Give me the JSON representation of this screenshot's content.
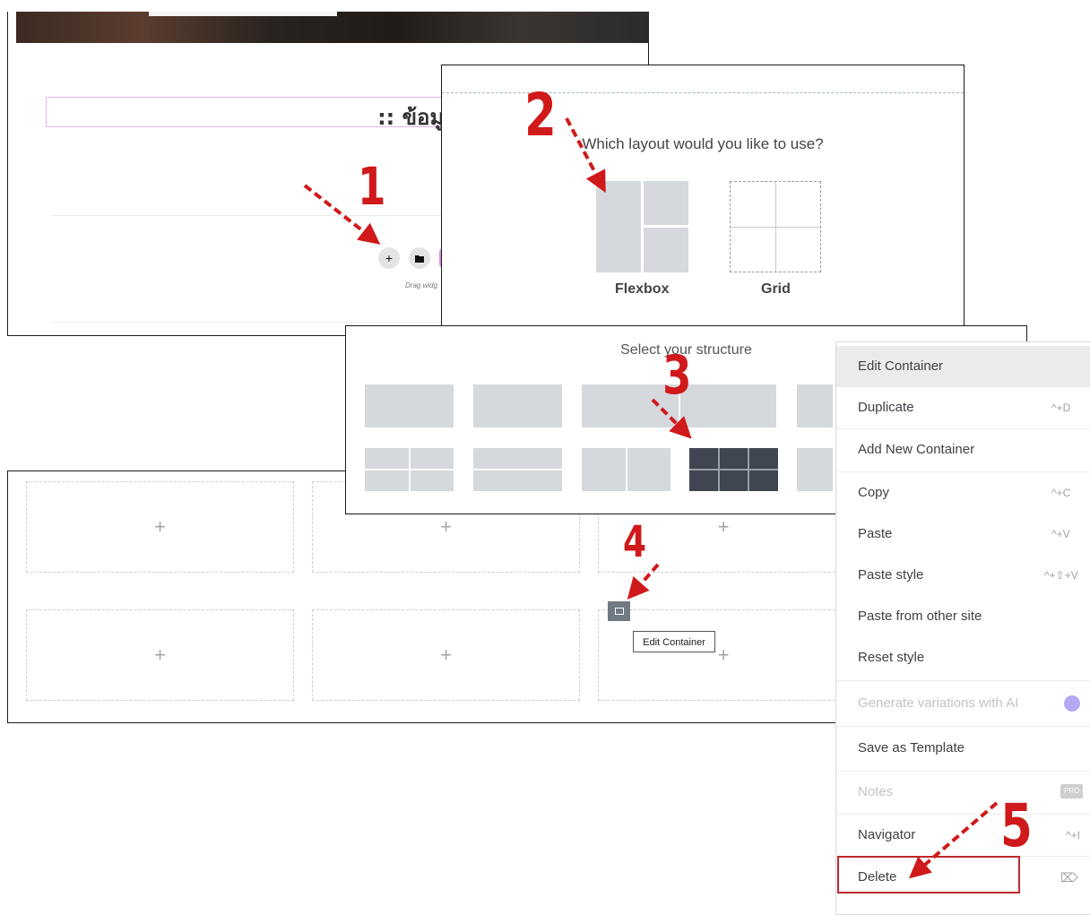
{
  "panel1": {
    "heading": ":: ข้อมูลเพ",
    "drag_hint": "Drag widg",
    "add_symbol": "+"
  },
  "layout_dialog": {
    "question": "Which layout would you like to use?",
    "option_flexbox": "Flexbox",
    "option_grid": "Grid"
  },
  "structure_dialog": {
    "title": "Select your structure"
  },
  "canvas": {
    "plus_symbol": "+",
    "tooltip": "Edit Container"
  },
  "context_menu": {
    "items": [
      {
        "label": "Edit Container",
        "shortcut": ""
      },
      {
        "label": "Duplicate",
        "shortcut": "^+D"
      },
      {
        "label": "Add New Container",
        "shortcut": ""
      },
      {
        "label": "Copy",
        "shortcut": "^+C"
      },
      {
        "label": "Paste",
        "shortcut": "^+V"
      },
      {
        "label": "Paste style",
        "shortcut": "^+⇧+V"
      },
      {
        "label": "Paste from other site",
        "shortcut": ""
      },
      {
        "label": "Reset style",
        "shortcut": ""
      },
      {
        "label": "Generate variations with AI",
        "shortcut": ""
      },
      {
        "label": "Save as Template",
        "shortcut": ""
      },
      {
        "label": "Notes",
        "shortcut": "PRO"
      },
      {
        "label": "Navigator",
        "shortcut": "^+I"
      },
      {
        "label": "Delete",
        "shortcut": "⌦"
      }
    ]
  },
  "step_numbers": [
    "1",
    "2",
    "3",
    "4",
    "5"
  ],
  "colors": {
    "annotation_red": "#d0191a",
    "selected_structure": "#3f4652",
    "ai_icon": "#9b8cf2"
  }
}
